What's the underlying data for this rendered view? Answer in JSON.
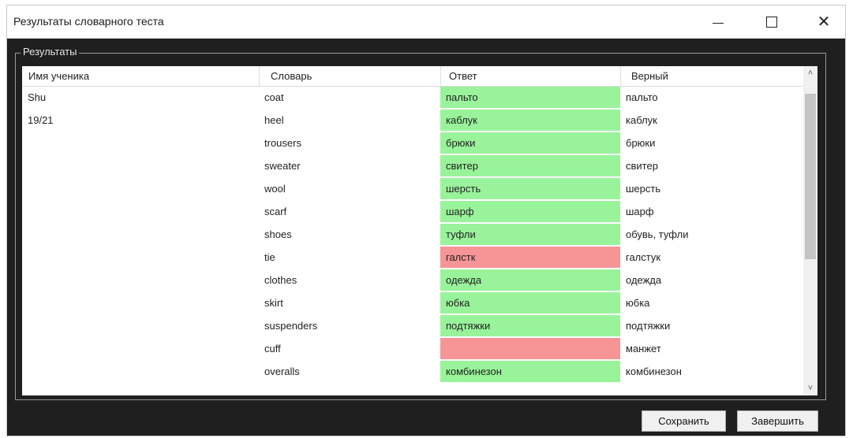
{
  "window": {
    "title": "Результаты словарного теста",
    "minimize_icon": "minimize-icon",
    "maximize_icon": "maximize-icon",
    "close_icon": "close-icon"
  },
  "group": {
    "label": "Результаты"
  },
  "table": {
    "columns": [
      "Имя ученика",
      "Словарь",
      "Ответ",
      "Верный"
    ],
    "rows": [
      {
        "student": "Shu",
        "word": "coat",
        "answer": "пальто",
        "correct": "пальто",
        "status": "ok"
      },
      {
        "student": "19/21",
        "word": "heel",
        "answer": "каблук",
        "correct": "каблук",
        "status": "ok"
      },
      {
        "student": "",
        "word": "trousers",
        "answer": "брюки",
        "correct": "брюки",
        "status": "ok"
      },
      {
        "student": "",
        "word": "sweater",
        "answer": "свитер",
        "correct": "свитер",
        "status": "ok"
      },
      {
        "student": "",
        "word": "wool",
        "answer": "шерсть",
        "correct": "шерсть",
        "status": "ok"
      },
      {
        "student": "",
        "word": "scarf",
        "answer": "шарф",
        "correct": "шарф",
        "status": "ok"
      },
      {
        "student": "",
        "word": "shoes",
        "answer": "туфли",
        "correct": "обувь, туфли",
        "status": "ok"
      },
      {
        "student": "",
        "word": "tie",
        "answer": "галстк",
        "correct": "галстук",
        "status": "bad"
      },
      {
        "student": "",
        "word": "clothes",
        "answer": "одежда",
        "correct": "одежда",
        "status": "ok"
      },
      {
        "student": "",
        "word": "skirt",
        "answer": "юбка",
        "correct": "юбка",
        "status": "ok"
      },
      {
        "student": "",
        "word": "suspenders",
        "answer": "подтяжки",
        "correct": "подтяжки",
        "status": "ok"
      },
      {
        "student": "",
        "word": "cuff",
        "answer": "",
        "correct": "манжет",
        "status": "bad"
      },
      {
        "student": "",
        "word": "overalls",
        "answer": "комбинезон",
        "correct": "комбинезон",
        "status": "ok"
      }
    ]
  },
  "colors": {
    "ok": "#99f39a",
    "bad": "#f79495",
    "background": "#1f1f1f"
  },
  "buttons": {
    "save": "Сохранить",
    "finish": "Завершить"
  }
}
